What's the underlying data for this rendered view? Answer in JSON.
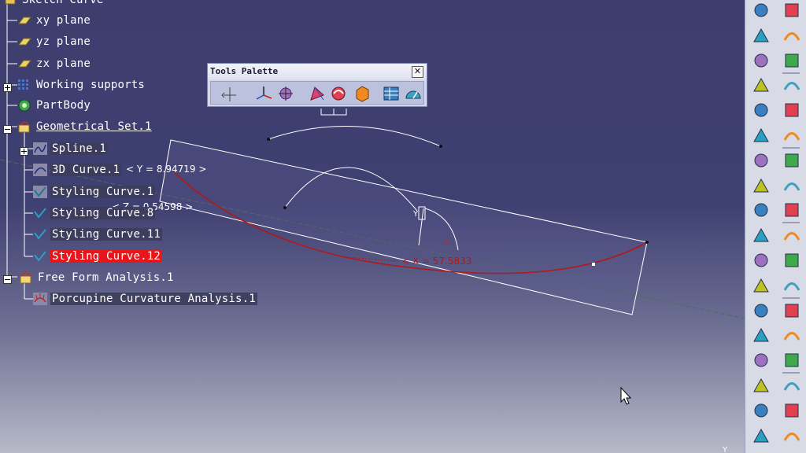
{
  "tree": {
    "root_label": "Sketch Curve",
    "items": [
      {
        "label": "xy plane",
        "icon": "plane-icon"
      },
      {
        "label": "yz plane",
        "icon": "plane-icon"
      },
      {
        "label": "zx plane",
        "icon": "plane-icon"
      },
      {
        "label": "Working supports",
        "icon": "working-supports-icon"
      },
      {
        "label": "PartBody",
        "icon": "partbody-icon"
      },
      {
        "label": "Geometrical Set.1",
        "icon": "geometrical-set-icon"
      },
      {
        "label": "Spline.1",
        "icon": "spline-icon"
      },
      {
        "label": "3D Curve.1",
        "icon": "3d-curve-icon"
      },
      {
        "label": "Styling Curve.1",
        "icon": "styling-curve-icon"
      },
      {
        "label": "Styling Curve.8",
        "icon": "styling-curve-icon"
      },
      {
        "label": "Styling Curve.11",
        "icon": "styling-curve-icon"
      },
      {
        "label": "Styling Curve.12",
        "icon": "styling-curve-icon"
      },
      {
        "label": "Free Form Analysis.1",
        "icon": "free-form-analysis-icon"
      },
      {
        "label": "Porcupine Curvature Analysis.1",
        "icon": "porcupine-analysis-icon"
      }
    ]
  },
  "palette": {
    "title": "Tools Palette",
    "close_label": "✕",
    "buttons": [
      "axis-manipulator-icon",
      "compass-icon",
      "snap-point-icon",
      "projection-icon",
      "rotate-icon",
      "solid-icon",
      "table-icon",
      "gauge-icon"
    ]
  },
  "viewport": {
    "readout_y": "< Y = 8.94719 >",
    "readout_z": "< Z = 0.54598 >",
    "readout_x": "< X = 57.5833",
    "compass_y_label": "Y",
    "compass_x_label": "X",
    "corner_label": "Y",
    "colors": {
      "curve": "#b31818",
      "construction": "#ffffff",
      "axis": "#556655"
    }
  },
  "toolbar": {
    "buttons": [
      "sketch-icon",
      "surface-icon",
      "select-arrow-icon",
      "cube-icon",
      "select-power-icon",
      "multi-cube-icon",
      "xyz-icon",
      "flip-face-icon",
      "snap-icon",
      "curve-3d-icon",
      "shape-fill-icon",
      "arc-icon",
      "ruler-icon",
      "arrow-curve-icon",
      "analysis-icon",
      "grid-icon",
      "check-icon",
      "pipe-icon",
      "plane-tool-icon",
      "curvature-icon",
      "sphere-icon",
      "stack-icon",
      "rectangle-icon",
      "layers-icon",
      "cone-icon",
      "mirror-icon",
      "blend-icon",
      "spheres-icon",
      "cube-red-icon",
      "dots-icon",
      "mesh-icon",
      "polyhedron-icon",
      "sphere-frame-icon",
      "lens-icon",
      "delete-icon",
      "brush-icon"
    ]
  }
}
